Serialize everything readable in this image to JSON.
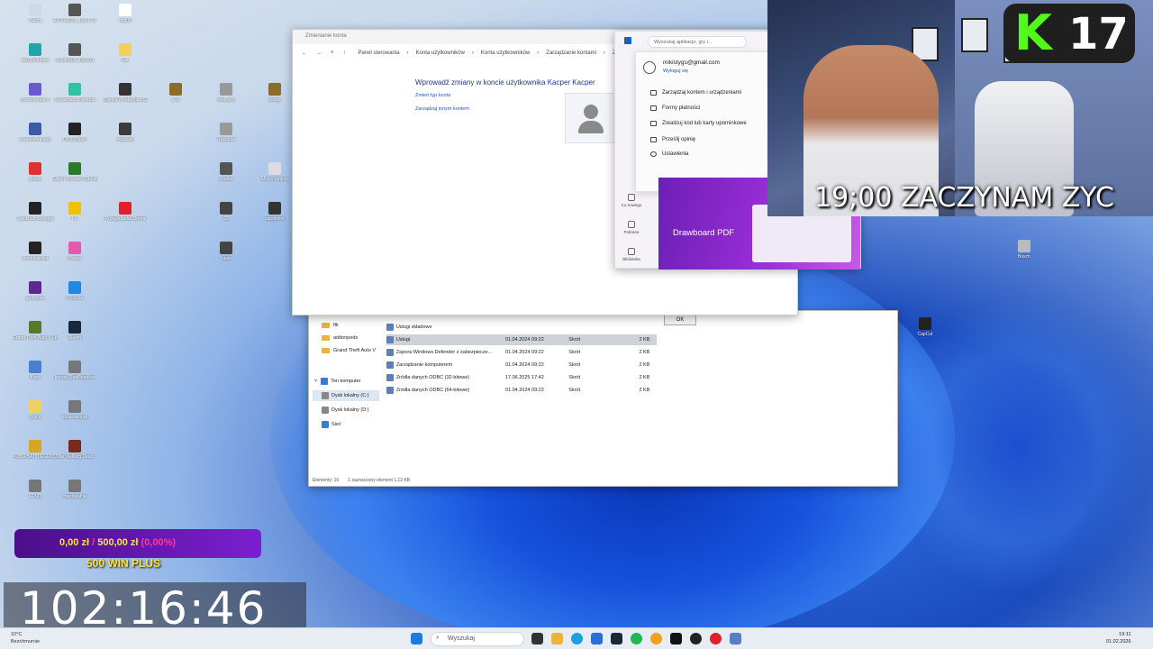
{
  "desktop": {
    "icons": [
      {
        "label": "7Micro",
        "color": "#cfd8e8"
      },
      {
        "label": "23.06.2023_18:37:29",
        "color": "#555"
      },
      {
        "label": "img00",
        "color": "#fff"
      },
      {
        "label": "app.Bulbanite",
        "color": "#1ea7a7"
      },
      {
        "label": "20240808_130103",
        "color": "#555"
      },
      {
        "label": "EA",
        "color": "#f0d060"
      },
      {
        "label": "Borderlands 4",
        "color": "#6a5acd"
      },
      {
        "label": "Streamlabs Desktop",
        "color": "#31c3a2"
      },
      {
        "label": "Zdjęcia WhatsApp 2024-05-20 o 16.31",
        "color": "#333"
      },
      {
        "label": "s7a",
        "color": "#8a6d2a"
      },
      {
        "label": "miki.jpeg",
        "color": "#999"
      },
      {
        "label": "image",
        "color": "#8a6d2a"
      },
      {
        "label": "screenshot.png",
        "color": "#3e5ba8"
      },
      {
        "label": "OBS Studio",
        "color": "#222"
      },
      {
        "label": "miyazaki",
        "color": "#3b3b3b"
      },
      {
        "label": "Rezalute",
        "color": "#999"
      },
      {
        "label": "gesdk",
        "color": "#e03030"
      },
      {
        "label": "Green Monster Gaming Chanel",
        "color": "#2a7a2a"
      },
      {
        "label": "czatka",
        "color": "#555"
      },
      {
        "label": "Mowy projekt",
        "color": "#ddd"
      },
      {
        "label": "StockholmStorage",
        "color": "#222"
      },
      {
        "label": "FK",
        "color": "#f2c200"
      },
      {
        "label": "Przeglądarka Opera",
        "color": "#e0202a"
      },
      {
        "label": "22",
        "color": "#444"
      },
      {
        "label": "zapobnior",
        "color": "#333"
      },
      {
        "label": "zimnokaczka",
        "color": "#222"
      },
      {
        "label": "iTunes",
        "color": "#e05ab0"
      },
      {
        "label": "kasia",
        "color": "#444"
      },
      {
        "label": "gridstone",
        "color": "#5b2a8a"
      },
      {
        "label": "VSCode",
        "color": "#1e88e5"
      },
      {
        "label": "Grand Theft Auto V Legacy",
        "color": "#567a2a"
      },
      {
        "label": "Steam",
        "color": "#1b2838"
      },
      {
        "label": "Kosz",
        "color": "#4a7fd0"
      },
      {
        "label": "Image_Spellbreaker",
        "color": "#777"
      },
      {
        "label": "Stacy",
        "color": "#f0d060"
      },
      {
        "label": "stolarskibrak",
        "color": "#777"
      },
      {
        "label": "PUBG BATTLEGROUNDS",
        "color": "#d9a526"
      },
      {
        "label": "The Walking Dead",
        "color": "#7a2a1a"
      },
      {
        "label": "FFNO",
        "color": "#777"
      },
      {
        "label": "maxlokalne",
        "color": "#777"
      },
      {
        "label": "Bosch",
        "color": "#bbb"
      },
      {
        "label": "CapCut",
        "color": "#222"
      }
    ]
  },
  "control_panel": {
    "title": "Zmienianie konta",
    "breadcrumbs": [
      "Panel sterowania",
      "Konta użytkowników",
      "Konta użytkowników",
      "Zarządzanie kontami",
      "Zmi"
    ],
    "heading": "Wprowadź zmiany w koncie użytkownika Kacper Kacper",
    "links": [
      "Zmień typ konta",
      "Zarządzaj innym kontem"
    ]
  },
  "explorer": {
    "folders": [
      "ftk",
      "addonpeds",
      "Grand Theft Auto V"
    ],
    "tree": [
      "Ten komputer",
      "Dysk lokalny (C:)",
      "Dysk lokalny (D:)",
      "Sieć"
    ],
    "files": [
      {
        "name": "Usługi składowe",
        "date": "",
        "type": "",
        "size": ""
      },
      {
        "name": "Usługi",
        "date": "01.04.2024 09:22",
        "type": "Skrót",
        "size": "2 KB"
      },
      {
        "name": "Zapora Windows Defender z zabezpiecze...",
        "date": "01.04.2024 09:22",
        "type": "Skrót",
        "size": "2 KB"
      },
      {
        "name": "Zarządzanie komputerem",
        "date": "01.04.2024 09:22",
        "type": "Skrót",
        "size": "2 KB"
      },
      {
        "name": "Źródła danych ODBC (32-bitowe)",
        "date": "17.06.2025 17:42",
        "type": "Skrót",
        "size": "2 KB"
      },
      {
        "name": "Źródła danych ODBC (64-bitowe)",
        "date": "01.04.2024 09:22",
        "type": "Skrót",
        "size": "2 KB"
      }
    ],
    "ok_label": "OK",
    "status_items": "Elementy: 16",
    "status_selected": "1 zaznaczony element 1,13 KB"
  },
  "store": {
    "search_placeholder": "Wyszukaj aplikacje, gry i...",
    "account_email": "mikistygs@gmail.com",
    "sign_out": "Wyloguj się",
    "menu": [
      "Zarządzaj kontem i urządzeniami",
      "Formy płatności",
      "Zrealizuj kod lub karty upominkowe",
      "Prześlij opinię",
      "Ustawienia"
    ],
    "sidebar": [
      "Co nowego",
      "Pobrane",
      "Biblioteka"
    ],
    "promo_title": "Drawboard PDF"
  },
  "overlay": {
    "kick_letter": "K",
    "kick_number": "17",
    "caption": "19;00 ZACZYNAM ZYC",
    "goal_current": "0,00 zł",
    "goal_target": "500,00 zł",
    "goal_percent": "(0,00%)",
    "goal_subtitle": "500 WIN PLUS",
    "timer": "102:16:46"
  },
  "taskbar": {
    "weather_temp": "10°C",
    "weather_desc": "Bezchmurnie",
    "search_label": "Wyszukaj",
    "time": "19:11",
    "date": "01.02.2026"
  },
  "colors": {
    "kick_green": "#53fc18",
    "goal_purple": "#7b1fd0",
    "timer_bg": "#28282f"
  }
}
